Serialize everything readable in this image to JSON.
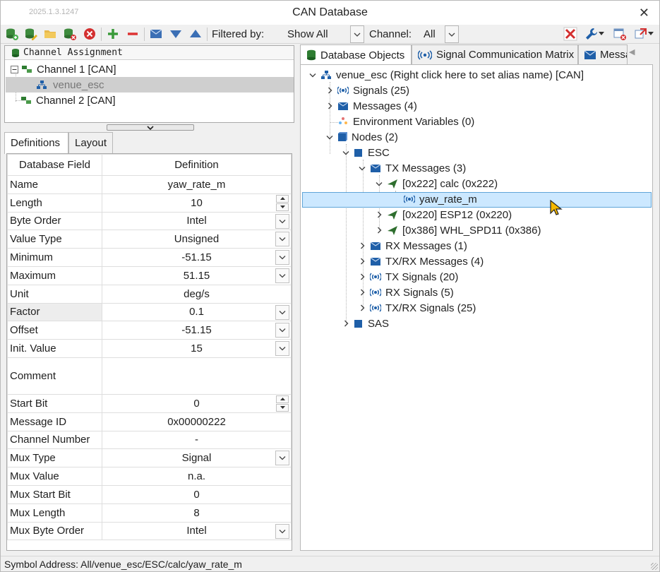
{
  "window": {
    "version": "2025.1.3.1247",
    "title": "CAN Database"
  },
  "toolbar": {
    "filter_label": "Filtered by:",
    "filter_value": "Show All",
    "channel_label": "Channel:",
    "channel_value": "All"
  },
  "channel_panel": {
    "header": "Channel Assignment",
    "items": [
      {
        "label": "Channel 1 [CAN]"
      },
      {
        "label": "venue_esc"
      },
      {
        "label": "Channel 2 [CAN]"
      }
    ]
  },
  "left_tabs": [
    {
      "label": "Definitions"
    },
    {
      "label": "Layout"
    }
  ],
  "definitions": {
    "col_field": "Database Field",
    "col_definition": "Definition",
    "rows": [
      {
        "field": "Name",
        "value": "yaw_rate_m"
      },
      {
        "field": "Length",
        "value": "10"
      },
      {
        "field": "Byte Order",
        "value": "Intel"
      },
      {
        "field": "Value Type",
        "value": "Unsigned"
      },
      {
        "field": "Minimum",
        "value": "-51.15"
      },
      {
        "field": "Maximum",
        "value": "51.15"
      },
      {
        "field": "Unit",
        "value": "deg/s"
      },
      {
        "field": "Factor",
        "value": "0.1"
      },
      {
        "field": "Offset",
        "value": "-51.15"
      },
      {
        "field": "Init. Value",
        "value": "15"
      },
      {
        "field": "Comment",
        "value": ""
      },
      {
        "field": "Start Bit",
        "value": "0"
      },
      {
        "field": "Message ID",
        "value": "0x00000222"
      },
      {
        "field": "Channel Number",
        "value": "-"
      },
      {
        "field": "Mux Type",
        "value": "Signal"
      },
      {
        "field": "Mux Value",
        "value": "n.a."
      },
      {
        "field": "Mux Start Bit",
        "value": "0"
      },
      {
        "field": "Mux Length",
        "value": "8"
      },
      {
        "field": "Mux Byte Order",
        "value": "Intel"
      }
    ]
  },
  "right_tabs": [
    {
      "label": "Database Objects"
    },
    {
      "label": "Signal Communication Matrix"
    },
    {
      "label": "Messa"
    }
  ],
  "tree": {
    "root": "venue_esc (Right click here to set alias name) [CAN]",
    "signals": "Signals (25)",
    "messages": "Messages (4)",
    "env_vars": "Environment Variables (0)",
    "nodes": "Nodes (2)",
    "esc": "ESC",
    "tx_messages": "TX Messages (3)",
    "calc": "[0x222] calc (0x222)",
    "yaw": "yaw_rate_m",
    "esp12": "[0x220] ESP12 (0x220)",
    "whl": "[0x386] WHL_SPD11 (0x386)",
    "rx_messages": "RX Messages (1)",
    "txrx_messages": "TX/RX Messages (4)",
    "tx_signals": "TX Signals (20)",
    "rx_signals": "RX Signals (5)",
    "txrx_signals": "TX/RX Signals (25)",
    "sas": "SAS"
  },
  "status": {
    "text": "Symbol Address: All/venue_esc/ESC/calc/yaw_rate_m"
  },
  "colors": {
    "selection": "#cce8ff",
    "selection_border": "#5fa5d8",
    "db_green": "#2e7d32",
    "msg_blue": "#1f5fa8",
    "remove_red": "#d32f2f"
  }
}
